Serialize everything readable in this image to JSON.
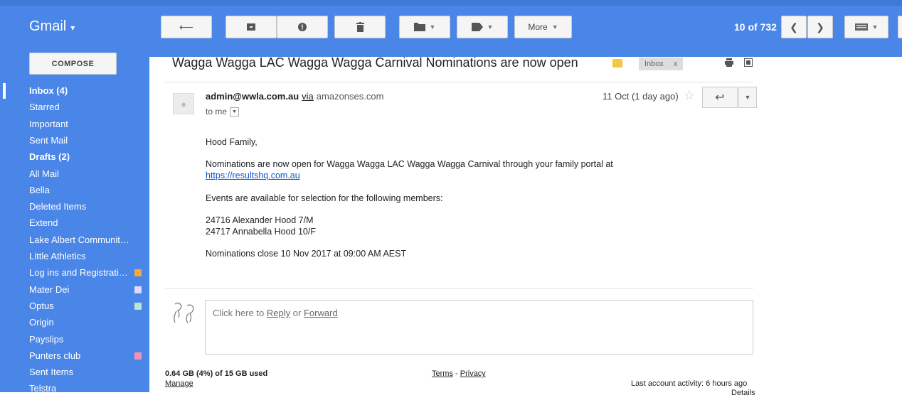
{
  "app": {
    "name": "Gmail"
  },
  "toolbar": {
    "back_icon": "arrow-left-icon",
    "archive_icon": "archive-icon",
    "spam_icon": "report-spam-icon",
    "delete_icon": "trash-icon",
    "move_icon": "folder-icon",
    "labels_icon": "tag-icon",
    "more_label": "More",
    "pager": "10 of 732",
    "accent": "#4a86e8"
  },
  "sidebar": {
    "compose_label": "COMPOSE",
    "items": [
      {
        "label": "Inbox (4)",
        "bold": true
      },
      {
        "label": "Starred"
      },
      {
        "label": "Important"
      },
      {
        "label": "Sent Mail"
      },
      {
        "label": "Drafts (2)",
        "bold": true
      },
      {
        "label": "All Mail"
      },
      {
        "label": "Bella"
      },
      {
        "label": "Deleted Items"
      },
      {
        "label": "Extend"
      },
      {
        "label": "Lake Albert Communit…"
      },
      {
        "label": "Little Athletics"
      },
      {
        "label": "Log ins and Registrati…",
        "color": "#f6a93b"
      },
      {
        "label": "Mater Dei",
        "color": "#e3d7ff"
      },
      {
        "label": "Optus",
        "color": "#b9e4d0"
      },
      {
        "label": "Origin"
      },
      {
        "label": "Payslips"
      },
      {
        "label": "Punters club",
        "color": "#f691b2"
      },
      {
        "label": "Sent Items"
      },
      {
        "label": "Telstra"
      }
    ]
  },
  "message": {
    "subject": "Wagga Wagga LAC Wagga Wagga Carnival Nominations are now open",
    "label_color": "#f6c73f",
    "inbox_chip": "Inbox",
    "inbox_chip_close": "x",
    "sender_email": "admin@wwla.com.au",
    "via": "via",
    "via_domain": "amazonses.com",
    "to": "to me",
    "date": "11 Oct (1 day ago)",
    "body": {
      "greeting": "Hood Family,",
      "line1": "Nominations are now open for Wagga Wagga LAC Wagga Wagga Carnival through your family portal at",
      "link": "https://resultshq.com.au",
      "line2": "Events are available for selection for the following members:",
      "member1": "24716 Alexander Hood 7/M",
      "member2": "24717 Annabella Hood 10/F",
      "close": "Nominations close 10 Nov 2017 at 09:00 AM AEST"
    }
  },
  "reply": {
    "prefix": "Click here to",
    "reply_link": "Reply",
    "or": "or",
    "forward_link": "Forward"
  },
  "footer": {
    "storage": "0.64 GB (4%) of 15 GB used",
    "manage": "Manage",
    "terms": "Terms",
    "sep": "-",
    "privacy": "Privacy",
    "activity": "Last account activity: 6 hours ago",
    "details": "Details"
  }
}
